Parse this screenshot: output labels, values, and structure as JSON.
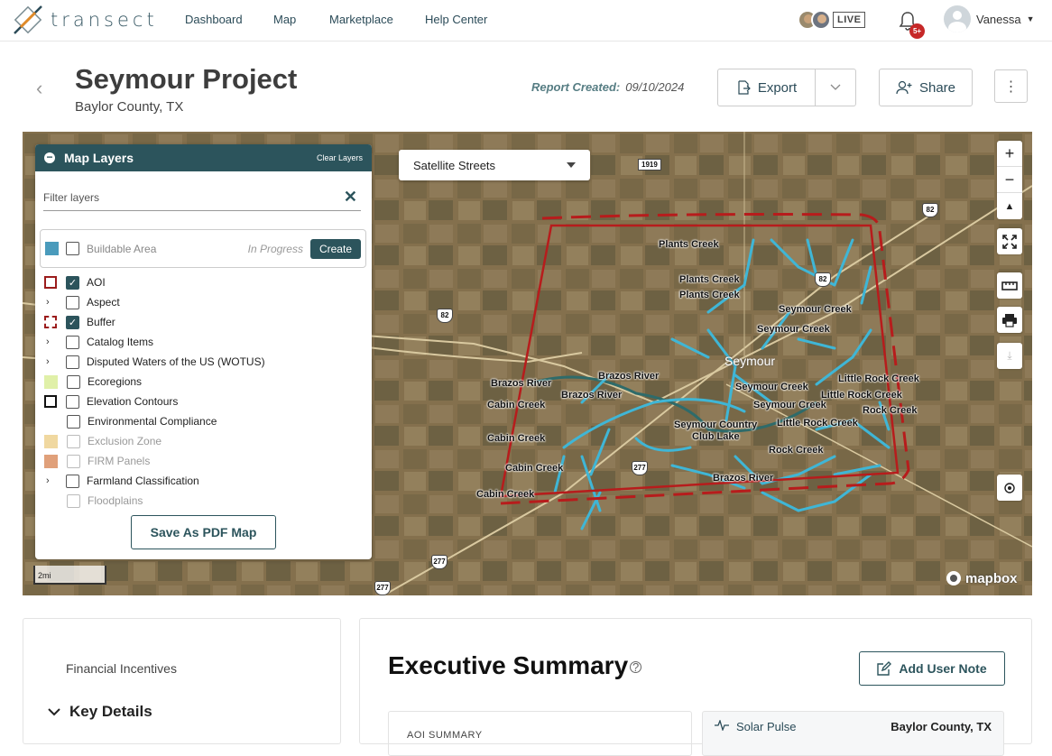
{
  "nav": {
    "logo": "transect",
    "links": [
      "Dashboard",
      "Map",
      "Marketplace",
      "Help Center"
    ],
    "live": "LIVE",
    "notifications": "5+",
    "user": "Vanessa"
  },
  "header": {
    "title": "Seymour Project",
    "subtitle": "Baylor County, TX",
    "report_label": "Report Created:",
    "report_date": "09/10/2024",
    "export": "Export",
    "share": "Share"
  },
  "map": {
    "style": "Satellite Streets",
    "town": "Seymour",
    "labels": [
      "Plants Creek",
      "Plants Creek",
      "Plants Creek",
      "Seymour Creek",
      "Seymour Creek",
      "Brazos River",
      "Brazos River",
      "Brazos River",
      "Cabin Creek",
      "Cabin Creek",
      "Cabin Creek",
      "Cabin Creek",
      "Seymour Creek",
      "Seymour Creek",
      "Seymour Country",
      "Club Lake",
      "Little Rock Creek",
      "Little Rock Creek",
      "Little Rock Creek",
      "Rock Creek",
      "Rock Creek",
      "Brazos River"
    ],
    "shields": [
      "1919",
      "82",
      "82",
      "82",
      "277",
      "277",
      "277"
    ],
    "scale": "2mi",
    "attribution": "mapbox",
    "colors": {
      "aoi": "#b71c1c",
      "streams": "#3fb6d6"
    }
  },
  "layers": {
    "title": "Map Layers",
    "clear": "Clear Layers",
    "filter_placeholder": "Filter layers",
    "buildable": {
      "label": "Buildable Area",
      "status": "In Progress",
      "action": "Create"
    },
    "items": [
      {
        "label": "AOI",
        "checked": true
      },
      {
        "label": "Aspect",
        "checked": false
      },
      {
        "label": "Buffer",
        "checked": true
      },
      {
        "label": "Catalog Items",
        "checked": false
      },
      {
        "label": "Disputed Waters of the US (WOTUS)",
        "checked": false
      },
      {
        "label": "Ecoregions",
        "checked": false
      },
      {
        "label": "Elevation Contours",
        "checked": false
      },
      {
        "label": "Environmental Compliance",
        "checked": false
      },
      {
        "label": "Exclusion Zone",
        "checked": false
      },
      {
        "label": "FIRM Panels",
        "checked": false
      },
      {
        "label": "Farmland Classification",
        "checked": false
      },
      {
        "label": "Floodplains",
        "checked": false
      }
    ],
    "save_pdf": "Save As PDF Map"
  },
  "left_panel": {
    "financial": "Financial Incentives",
    "key_details": "Key Details"
  },
  "summary": {
    "title": "Executive Summary",
    "add_note": "Add User Note",
    "aoi_summary": "AOI SUMMARY",
    "pulse_label": "Solar Pulse",
    "pulse_county": "Baylor County, TX"
  }
}
